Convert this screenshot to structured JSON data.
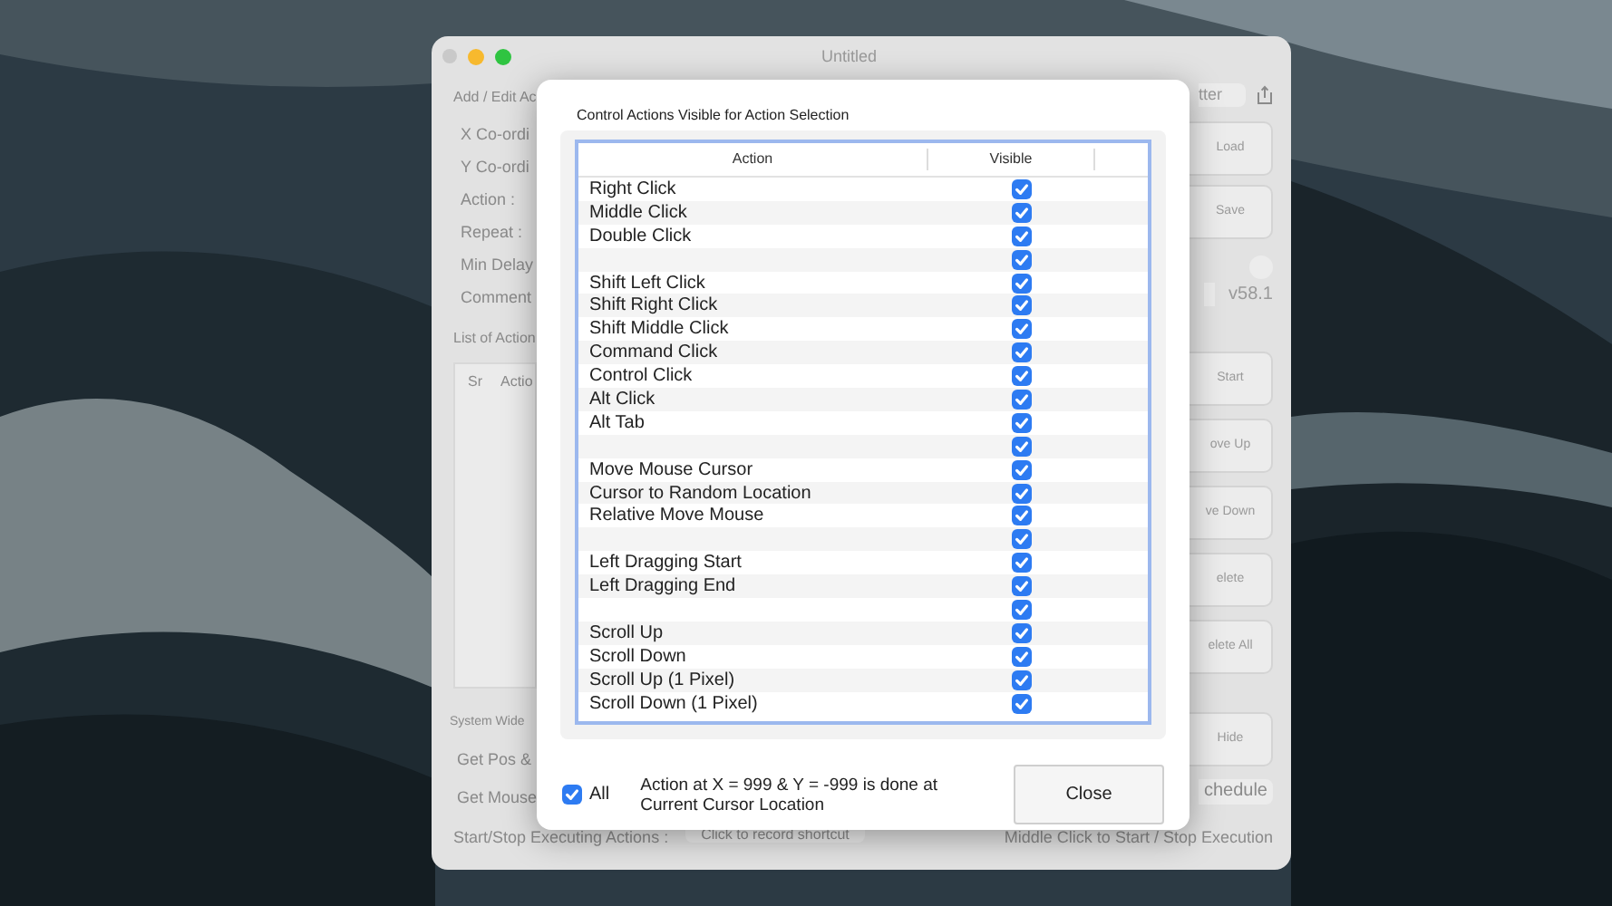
{
  "window": {
    "title": "Untitled",
    "left_panel": {
      "section": "Add / Edit Ac",
      "fields": [
        "X Co-ordi",
        "Y Co-ordi",
        "Action :",
        "Repeat :",
        "Min Delay",
        "Comment"
      ],
      "list_title": "List of Action",
      "list_columns": [
        "Sr",
        "Actio"
      ],
      "system_section": "System Wide",
      "system_items": [
        "Get Pos &",
        "Get Mouse"
      ]
    },
    "right_panel": {
      "top_field": "tter",
      "buttons_top": [
        "Load",
        "Save"
      ],
      "version": "v58.1",
      "buttons": [
        "Start",
        "ove Up",
        "ve Down",
        "elete",
        "elete All"
      ],
      "hide_button": "Hide",
      "schedule_button": "chedule"
    },
    "bottom": {
      "label": "Start/Stop Executing Actions :",
      "shortcut_button": "Click to record shortcut",
      "hint": "Middle Click to Start / Stop Execution"
    }
  },
  "dialog": {
    "title": "Control Actions Visible for Action Selection",
    "columns": [
      "Action",
      "Visible"
    ],
    "rows": [
      {
        "action": "Right Click",
        "visible": true
      },
      {
        "action": "Middle Click",
        "visible": true
      },
      {
        "action": "Double Click",
        "visible": true
      },
      {
        "visible": true
      },
      {
        "action": "Shift Left Click",
        "visible": true
      },
      {
        "action": "Shift Right Click",
        "visible": true
      },
      {
        "action": "Shift Middle Click",
        "visible": true
      },
      {
        "action": "Command Click",
        "visible": true
      },
      {
        "action": "Control Click",
        "visible": true
      },
      {
        "action": "Alt Click",
        "visible": true
      },
      {
        "action": "Alt Tab",
        "visible": true
      },
      {
        "visible": true
      },
      {
        "action": "Move Mouse Cursor",
        "visible": true
      },
      {
        "action": "Cursor to Random Location",
        "visible": true
      },
      {
        "action": "Relative Move Mouse",
        "visible": true
      },
      {
        "visible": true
      },
      {
        "action": "Left Dragging Start",
        "visible": true
      },
      {
        "action": "Left Dragging End",
        "visible": true
      },
      {
        "visible": true
      },
      {
        "action": "Scroll Up",
        "visible": true
      },
      {
        "action": "Scroll Down",
        "visible": true
      },
      {
        "action": "Scroll Up (1 Pixel)",
        "visible": true
      },
      {
        "action": "Scroll Down (1 Pixel)",
        "visible": true
      }
    ],
    "all": {
      "label": "All",
      "checked": true
    },
    "note": "Action at X = 999 & Y = -999 is done at Current Cursor Location",
    "close_button": "Close"
  }
}
